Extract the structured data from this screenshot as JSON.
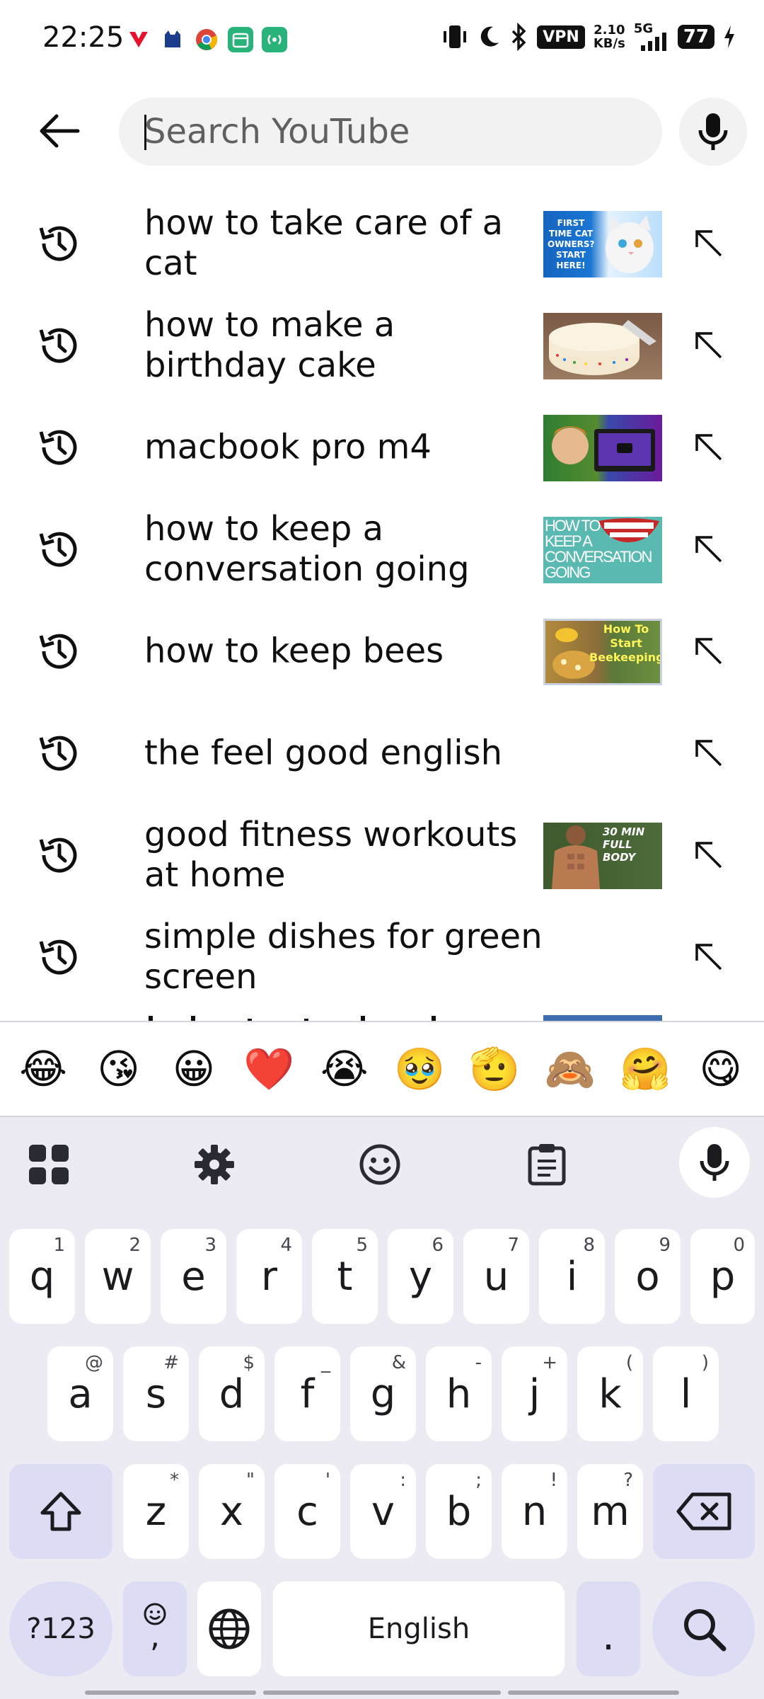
{
  "status_bar": {
    "time": "22:25",
    "net_speed_value": "2.10",
    "net_speed_unit": "KB/s",
    "vpn_label": "VPN",
    "network_label": "5G",
    "battery": "77"
  },
  "search": {
    "placeholder": "Search YouTube",
    "value": ""
  },
  "suggestions": [
    {
      "text": "how to take care of a cat",
      "thumb_caption": "FIRST TIME CAT OWNERS? START HERE!"
    },
    {
      "text": "how to make a birthday cake",
      "thumb_caption": ""
    },
    {
      "text": "macbook pro m4",
      "thumb_caption": ""
    },
    {
      "text": "how to keep a conversation going",
      "thumb_caption": "HOW TO KEEP A CONVERSATION GOING"
    },
    {
      "text": "how to keep bees",
      "thumb_caption": "How To Start Beekeeping"
    },
    {
      "text": "the feel good english",
      "thumb_caption": ""
    },
    {
      "text": "good fitness workouts at home",
      "thumb_caption": "30 MIN FULL BODY"
    },
    {
      "text": "simple dishes for green screen",
      "thumb_caption": ""
    }
  ],
  "keyboard": {
    "emojis": [
      "😂",
      "😘",
      "😀",
      "❤️",
      "😭",
      "🥹",
      "🫡",
      "🙈",
      "🤗",
      "😋"
    ],
    "row1": [
      {
        "k": "q",
        "h": "1"
      },
      {
        "k": "w",
        "h": "2"
      },
      {
        "k": "e",
        "h": "3"
      },
      {
        "k": "r",
        "h": "4"
      },
      {
        "k": "t",
        "h": "5"
      },
      {
        "k": "y",
        "h": "6"
      },
      {
        "k": "u",
        "h": "7"
      },
      {
        "k": "i",
        "h": "8"
      },
      {
        "k": "o",
        "h": "9"
      },
      {
        "k": "p",
        "h": "0"
      }
    ],
    "row2": [
      {
        "k": "a",
        "h": "@"
      },
      {
        "k": "s",
        "h": "#"
      },
      {
        "k": "d",
        "h": "$"
      },
      {
        "k": "f",
        "h": "_"
      },
      {
        "k": "g",
        "h": "&"
      },
      {
        "k": "h",
        "h": "-"
      },
      {
        "k": "j",
        "h": "+"
      },
      {
        "k": "k",
        "h": "("
      },
      {
        "k": "l",
        "h": ")"
      }
    ],
    "row3": [
      {
        "k": "z",
        "h": "*"
      },
      {
        "k": "x",
        "h": "\""
      },
      {
        "k": "c",
        "h": "'"
      },
      {
        "k": "v",
        "h": ":"
      },
      {
        "k": "b",
        "h": ";"
      },
      {
        "k": "n",
        "h": "!"
      },
      {
        "k": "m",
        "h": "?"
      }
    ],
    "symbols_label": "?123",
    "comma_label": ",",
    "space_label": "English",
    "period_label": "."
  },
  "colors": {
    "keyboard_bg": "#eceaf3",
    "special_key": "#dcdcf5",
    "youtube_red": "#ff0000"
  }
}
